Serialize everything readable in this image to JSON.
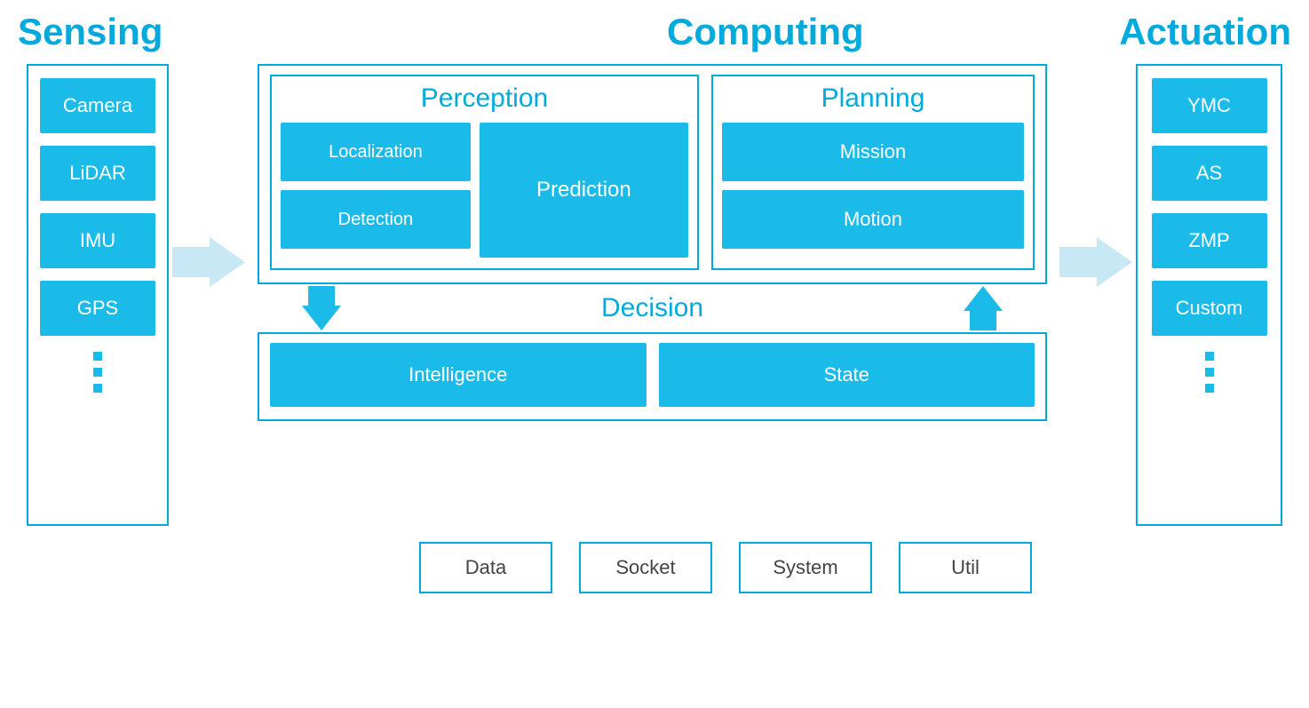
{
  "titles": {
    "sensing": "Sensing",
    "computing": "Computing",
    "actuation": "Actuation",
    "perception": "Perception",
    "planning": "Planning",
    "decision": "Decision"
  },
  "sensing_items": [
    "Camera",
    "LiDAR",
    "IMU",
    "GPS"
  ],
  "perception": {
    "localization": "Localization",
    "detection": "Detection",
    "prediction": "Prediction"
  },
  "planning": {
    "mission": "Mission",
    "motion": "Motion"
  },
  "decision": {
    "intelligence": "Intelligence",
    "state": "State"
  },
  "actuation_items": [
    "YMC",
    "AS",
    "ZMP",
    "Custom"
  ],
  "bottom_items": [
    "Data",
    "Socket",
    "System",
    "Util"
  ]
}
